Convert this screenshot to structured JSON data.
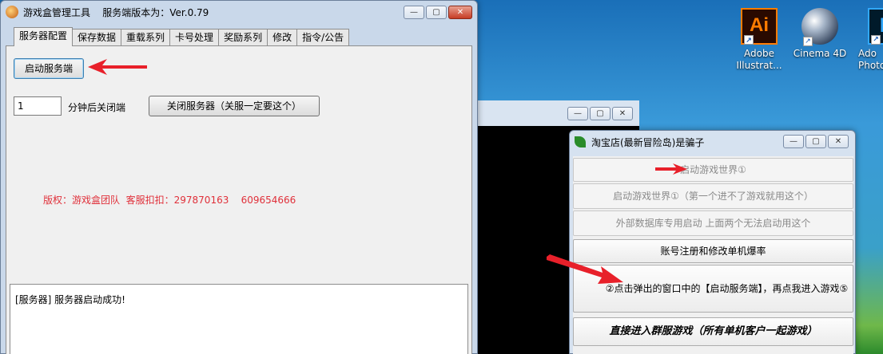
{
  "desktop": {
    "icons": [
      {
        "label_line1": "Adobe",
        "label_line2": "Illustrat...",
        "glyph": "Ai"
      },
      {
        "label_line1": "Cinema 4D",
        "label_line2": ""
      },
      {
        "label_line1": "Ado",
        "label_line2": "Photo",
        "glyph": "P"
      }
    ],
    "shortcut_glyph": "↗"
  },
  "main_window": {
    "title": "游戏盒管理工具    服务端版本为：Ver.0.79",
    "controls": {
      "minimize": "—",
      "maximize": "▢",
      "close": "✕"
    },
    "tabs": [
      "服务器配置",
      "保存数据",
      "重载系列",
      "卡号处理",
      "奖励系列",
      "修改",
      "指令/公告"
    ],
    "active_tab": "服务器配置",
    "start_button": "启动服务端",
    "minutes_value": "1",
    "minutes_label": "分钟后关闭端",
    "close_server_button": "关闭服务器（关服一定要这个）",
    "copyright": "版权：游戏盒团队  客服扣扣：297870163    609654666",
    "log_text": "[服务器] 服务器启动成功!"
  },
  "launcher_window": {
    "title": "淘宝店(最新冒险岛)是骗子",
    "controls": {
      "minimize": "—",
      "maximize": "▢",
      "close": "✕"
    },
    "buttons": {
      "start_world_1": "启动游戏世界①",
      "start_world_1_alt": "启动游戏世界①（第一个进不了游戏就用这个）",
      "external_db": "外部数据库专用启动  上面两个无法启动用这个",
      "account_register": "账号注册和修改单机爆率",
      "enter_game_step": "②点击弹出的窗口中的【启动服务端】，再点我进入游戏⑤",
      "join_group_server": "直接进入群服游戏（所有单机客户一起游戏）"
    }
  },
  "annotations": {
    "arrow_color": "#e8202a"
  }
}
